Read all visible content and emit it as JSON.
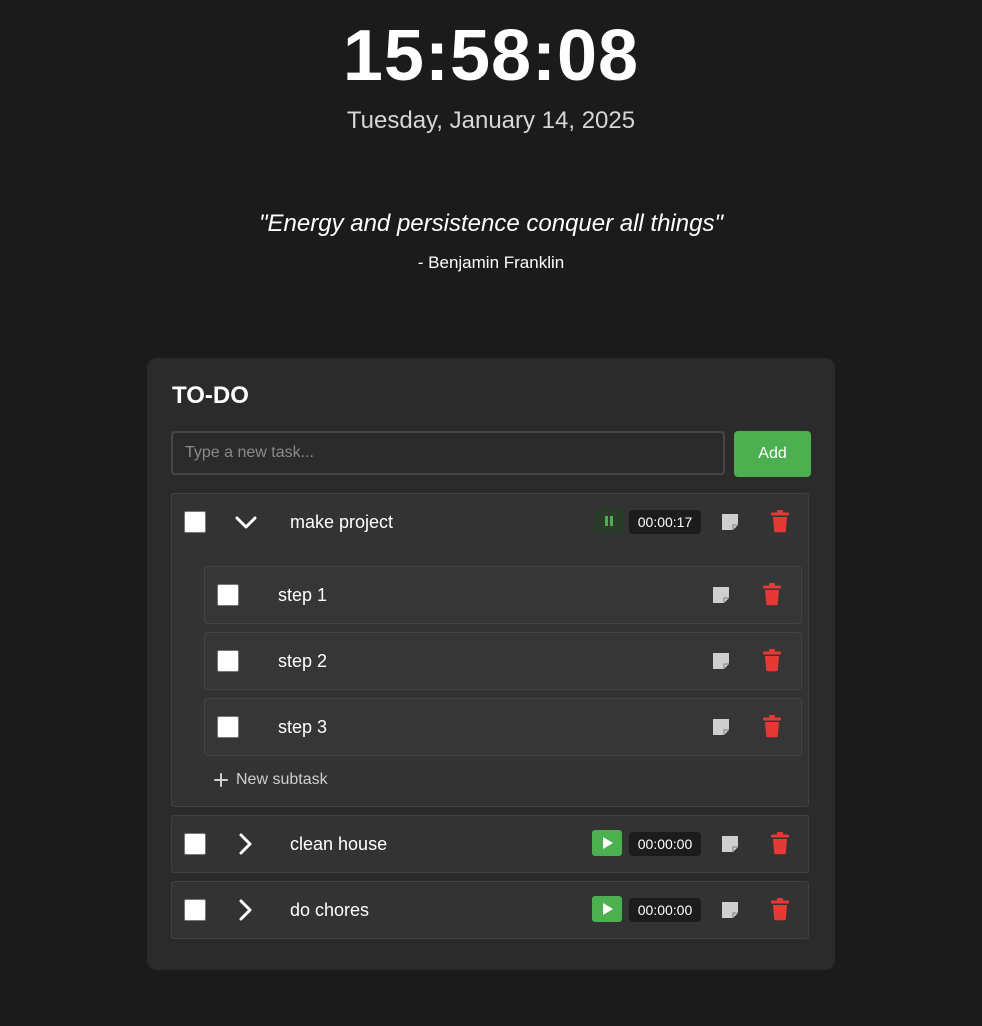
{
  "clock": {
    "time": "15:58:08",
    "date": "Tuesday, January 14, 2025"
  },
  "quote": {
    "text": "\"Energy and persistence conquer all things\"",
    "author": "- Benjamin Franklin"
  },
  "todo": {
    "title": "TO-DO",
    "input_placeholder": "Type a new task...",
    "add_label": "Add",
    "new_subtask_label": "New subtask",
    "tasks": [
      {
        "name": "make project",
        "expanded": true,
        "timer_state": "running",
        "timer": "00:00:17",
        "subtasks": [
          {
            "name": "step 1"
          },
          {
            "name": "step 2"
          },
          {
            "name": "step 3"
          }
        ]
      },
      {
        "name": "clean house",
        "expanded": false,
        "timer_state": "paused",
        "timer": "00:00:00"
      },
      {
        "name": "do chores",
        "expanded": false,
        "timer_state": "paused",
        "timer": "00:00:00"
      }
    ]
  },
  "colors": {
    "background": "#1b1b1b",
    "card": "#2b2b2b",
    "accent_green": "#4caf50",
    "delete_red": "#e53935",
    "note_gray": "#cfcfcf"
  },
  "icons": {
    "expanded": "chevron-down-icon",
    "collapsed": "chevron-right-icon",
    "running": "pause-icon",
    "paused": "play-icon",
    "note": "note-icon",
    "delete": "trash-icon",
    "add_subtask": "plus-icon"
  }
}
